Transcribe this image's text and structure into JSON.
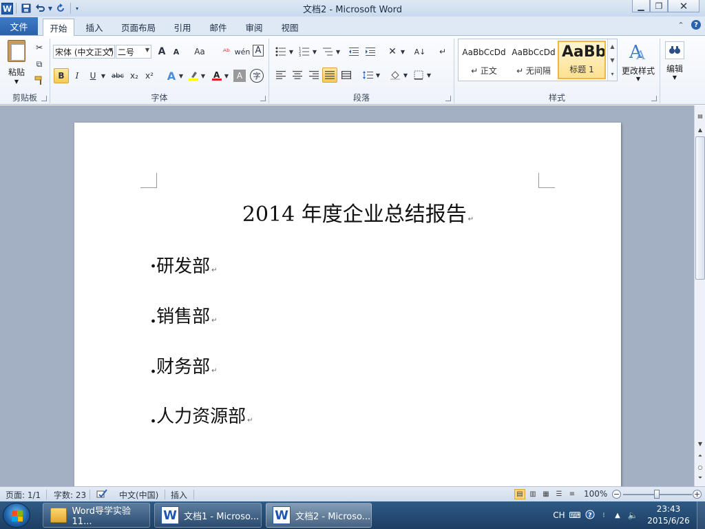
{
  "window": {
    "title": "文档2 - Microsoft Word",
    "app_icon": "W"
  },
  "quick_access": {
    "icons": [
      "save-icon",
      "undo-icon",
      "redo-icon",
      "customize-icon"
    ]
  },
  "tabs": {
    "file": "文件",
    "items": [
      "开始",
      "插入",
      "页面布局",
      "引用",
      "邮件",
      "审阅",
      "视图"
    ],
    "active": "开始"
  },
  "ribbon": {
    "clipboard": {
      "paste_label": "粘贴",
      "group_label": "剪贴板"
    },
    "font": {
      "font_name": "宋体 (中文正文)",
      "font_size": "二号",
      "group_label": "字体",
      "buttons": [
        "B",
        "I",
        "U",
        "abc",
        "x₂",
        "x²"
      ],
      "grow": "A",
      "shrink": "A",
      "change_case": "Aa",
      "clear": "A",
      "border_char": "A",
      "enclose": "字"
    },
    "paragraph": {
      "group_label": "段落"
    },
    "styles": {
      "group_label": "样式",
      "items": [
        {
          "sample": "AaBbCcDd",
          "name": "↵ 正文"
        },
        {
          "sample": "AaBbCcDd",
          "name": "↵ 无间隔"
        },
        {
          "sample": "AaBb",
          "name": "标题 1"
        }
      ],
      "change_styles": "更改样式"
    },
    "editing": {
      "label": "编辑"
    }
  },
  "document": {
    "title": "2014 年度企业总结报告",
    "paragraph_mark": "↵",
    "items": [
      {
        "bullet": "·",
        "text": "研发部"
      },
      {
        "bullet": ".",
        "text": "销售部"
      },
      {
        "bullet": ".",
        "text": "财务部"
      },
      {
        "bullet": ".",
        "text": "人力资源部"
      }
    ]
  },
  "status_bar": {
    "page": "页面: 1/1",
    "words": "字数: 23",
    "language": "中文(中国)",
    "mode": "插入",
    "zoom": "100%"
  },
  "taskbar": {
    "tasks": [
      {
        "label": "Word导学实验11...",
        "icon": "folder-icon"
      },
      {
        "label": "文档1 - Microso...",
        "icon": "word-icon"
      },
      {
        "label": "文档2 - Microso...",
        "icon": "word-icon"
      }
    ],
    "active_task": "文档2 - Microso...",
    "tray": {
      "ime": "CH"
    },
    "clock_time": "23:43",
    "clock_date": "2015/6/26"
  },
  "colors": {
    "file_tab": "#2a5fa9",
    "highlight": "#f8c954",
    "taskbar": "#1c3e64"
  }
}
